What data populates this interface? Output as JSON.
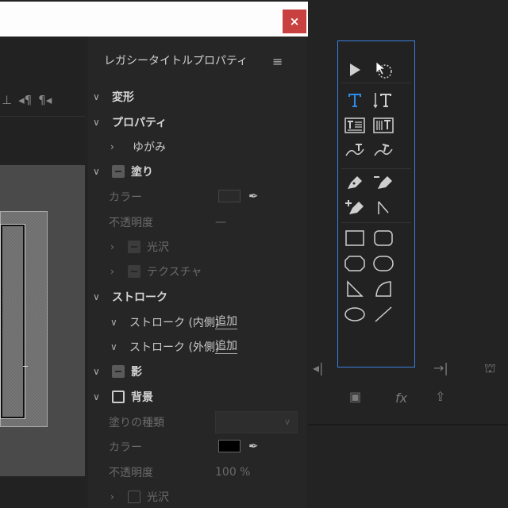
{
  "windows": {
    "left_close": "×",
    "right_close": "×"
  },
  "left_toolbar": {
    "icons": [
      "tab-align-icon",
      "paragraph-left-icon",
      "paragraph-icon"
    ],
    "glyphs": [
      "⊥",
      "◂¶",
      "¶◂"
    ]
  },
  "properties": {
    "title": "レガシータイトルプロパティ",
    "menu_glyph": "≡",
    "transform": "変形",
    "properties": "プロパティ",
    "distort": "ゆがみ",
    "fill": "塗り",
    "fill_color": "カラー",
    "fill_opacity": "不透明度",
    "fill_opacity_value": "—",
    "sheen": "光沢",
    "texture": "テクスチャ",
    "stroke": "ストローク",
    "inner_stroke": "ストローク (内側)",
    "inner_add": "追加",
    "outer_stroke": "ストローク (外側)",
    "outer_add": "追加",
    "shadow": "影",
    "background": "背景",
    "fill_type": "塗りの種類",
    "bg_color": "カラー",
    "bg_color_hex": "#000000",
    "bg_opacity": "不透明度",
    "bg_opacity_value": "100 %",
    "bg_sheen": "光沢"
  },
  "tools": [
    "selection-tool",
    "rotation-tool",
    "type-tool",
    "vertical-type-tool",
    "area-type-tool",
    "vertical-area-type-tool",
    "path-type-tool",
    "vertical-path-type-tool",
    "pen-tool",
    "delete-anchor-tool",
    "add-anchor-tool",
    "convert-anchor-tool",
    "rectangle-tool",
    "rounded-rectangle-tool",
    "clipped-corner-rectangle-tool",
    "rounded-corner-rectangle-tool",
    "wedge-tool",
    "arc-tool",
    "ellipse-tool",
    "line-tool"
  ],
  "right_controls": {
    "fx": "fx"
  },
  "colors": {
    "accent": "#2d8ceb",
    "close": "#c94040",
    "tools_border": "#3b7fe0"
  }
}
